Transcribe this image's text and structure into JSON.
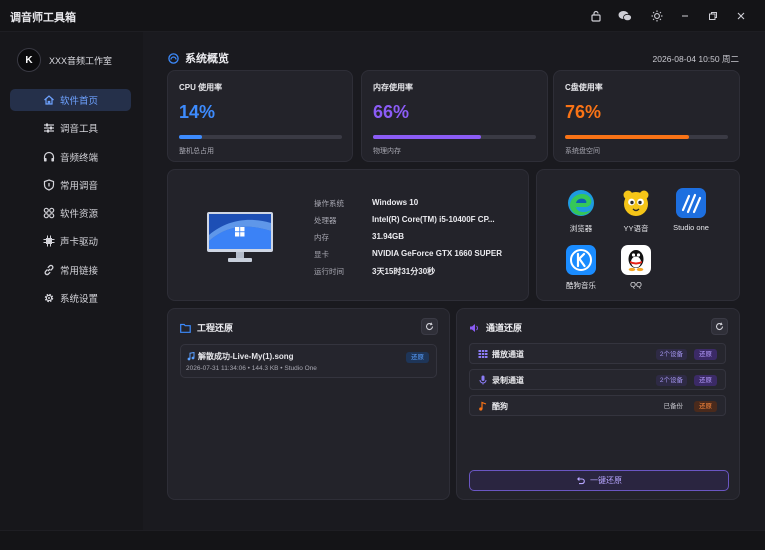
{
  "window": {
    "title": "调音师工具箱"
  },
  "brand": {
    "name": "XXX音频工作室",
    "logo_letter": "K"
  },
  "sidebar": {
    "items": [
      {
        "label": "软件首页",
        "icon": "home-icon",
        "active": true
      },
      {
        "label": "调音工具",
        "icon": "sliders-icon",
        "active": false
      },
      {
        "label": "音频终端",
        "icon": "headphones-icon",
        "active": false
      },
      {
        "label": "常用调音",
        "icon": "shield-icon",
        "active": false
      },
      {
        "label": "软件资源",
        "icon": "grid-icon",
        "active": false
      },
      {
        "label": "声卡驱动",
        "icon": "chip-icon",
        "active": false
      },
      {
        "label": "常用链接",
        "icon": "link-icon",
        "active": false
      },
      {
        "label": "系统设置",
        "icon": "gear-icon",
        "active": false
      }
    ]
  },
  "overview": {
    "title": "系统概览",
    "datetime": "2026-08-04 10:50 周二"
  },
  "stats": [
    {
      "label": "CPU 使用率",
      "value": "14%",
      "percent": 14,
      "sub": "整机总占用",
      "color": "#3d8bfd"
    },
    {
      "label": "内存使用率",
      "value": "66%",
      "percent": 66,
      "sub": "物理内存",
      "color": "#8b5cf6"
    },
    {
      "label": "C盘使用率",
      "value": "76%",
      "percent": 76,
      "sub": "系统盘空间",
      "color": "#f97316"
    }
  ],
  "specs": [
    {
      "key": "操作系统",
      "value": "Windows 10"
    },
    {
      "key": "处理器",
      "value": "Intel(R) Core(TM) i5-10400F CP..."
    },
    {
      "key": "内存",
      "value": "31.94GB"
    },
    {
      "key": "显卡",
      "value": "NVIDIA GeForce GTX 1660 SUPER"
    },
    {
      "key": "运行时间",
      "value": "3天15时31分30秒"
    }
  ],
  "apps": [
    {
      "name": "浏览器",
      "icon": "edge-browser-icon"
    },
    {
      "name": "YY语音",
      "icon": "yy-voice-icon"
    },
    {
      "name": "Studio one",
      "icon": "studio-one-icon"
    },
    {
      "name": "酷狗音乐",
      "icon": "kugou-icon"
    },
    {
      "name": "QQ",
      "icon": "qq-penguin-icon"
    }
  ],
  "project_restore": {
    "title": "工程还原",
    "file": {
      "name": "解散成功-Live-My(1).song",
      "meta": "2026-07-31 11:34:06 • 144.3 KB • Studio One",
      "action": "还原"
    }
  },
  "channel_restore": {
    "title": "通道还原",
    "channels": [
      {
        "name": "播放通道",
        "badge": "2个设备",
        "action": "还原",
        "icon": "playback-grid-icon"
      },
      {
        "name": "录制通道",
        "badge": "2个设备",
        "action": "还原",
        "icon": "microphone-icon"
      },
      {
        "name": "酷狗",
        "badge": "已备份",
        "action": "还原",
        "icon": "music-note-icon"
      }
    ],
    "restore_all": "一键还原"
  },
  "colors": {
    "accent": "#3d8bfd",
    "purple": "#8b5cf6",
    "orange": "#f97316"
  }
}
